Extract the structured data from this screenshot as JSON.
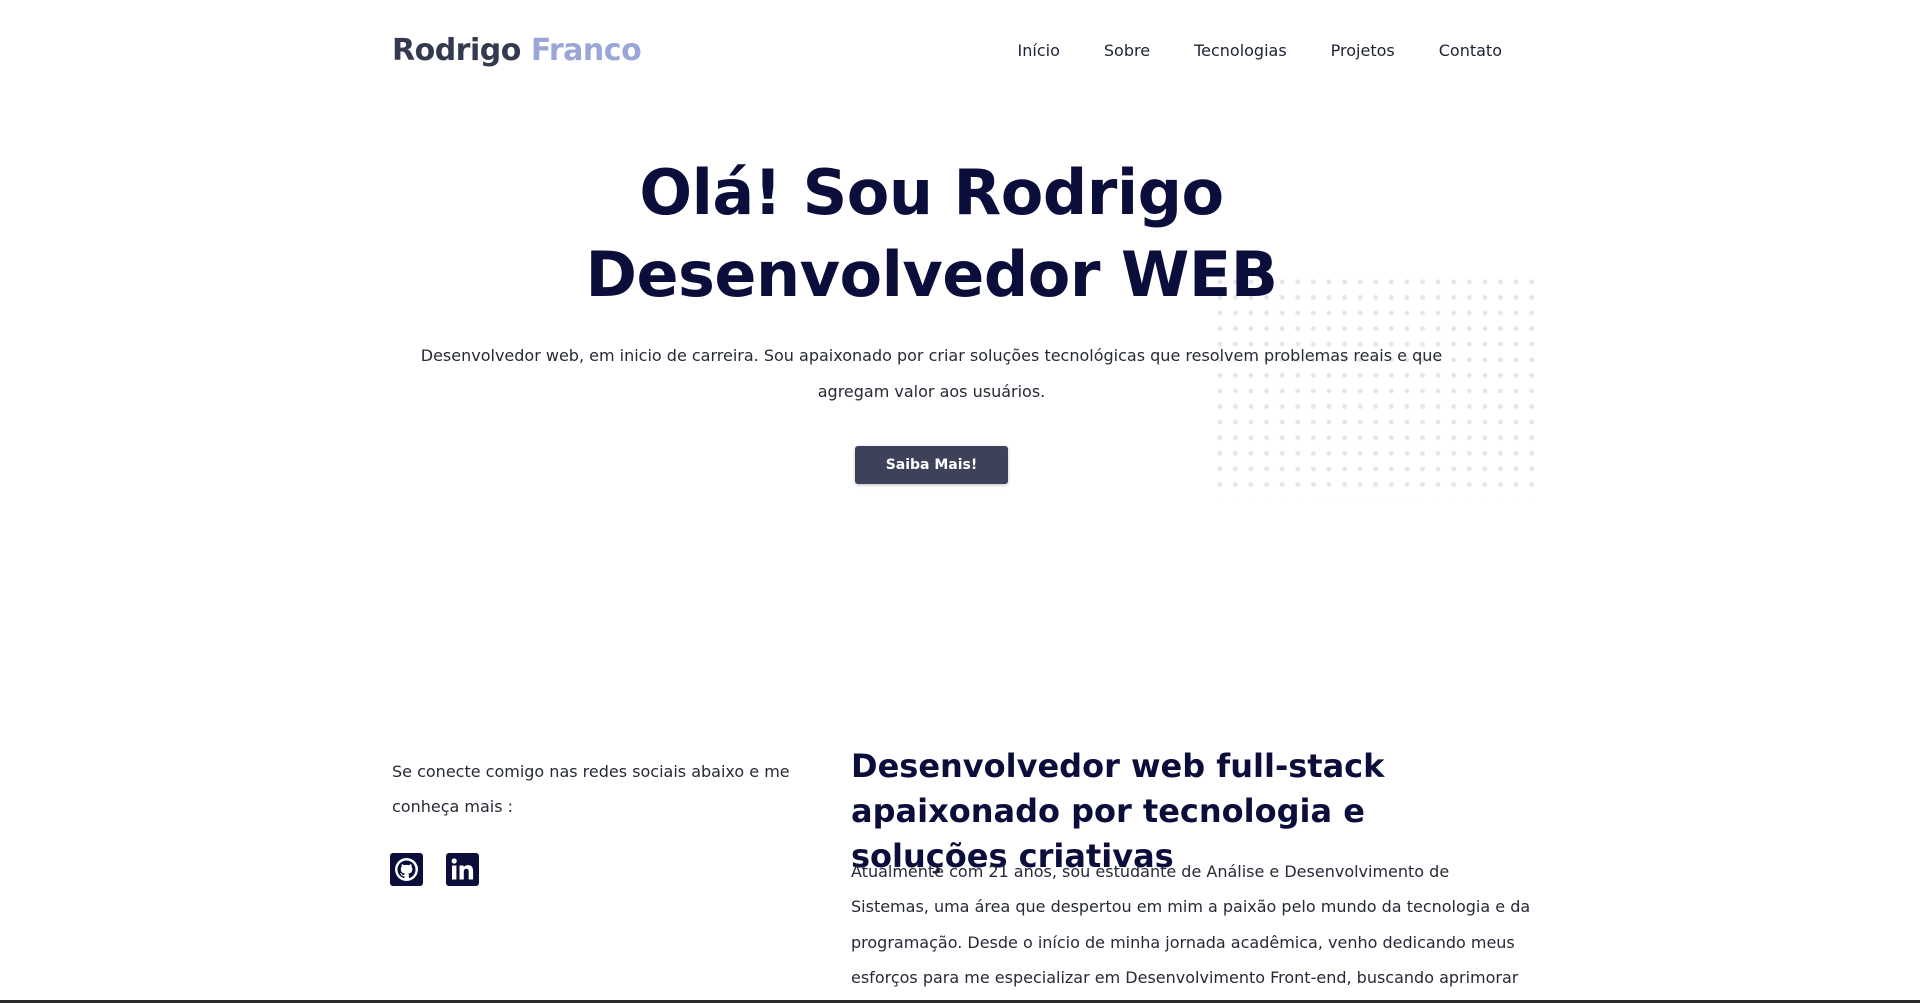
{
  "header": {
    "logo_first": "Rodrigo",
    "logo_last": "Franco",
    "nav": [
      "Início",
      "Sobre",
      "Tecnologias",
      "Projetos",
      "Contato"
    ]
  },
  "hero": {
    "title": "Olá! Sou Rodrigo Desenvolvedor WEB",
    "description": "Desenvolvedor web, em inicio de carreira. Sou apaixonado por criar soluções tecnológicas que resolvem problemas reais e que agregam valor aos usuários.",
    "cta_label": "Saiba Mais!"
  },
  "about": {
    "social_text": "Se conecte comigo nas redes sociais abaixo e me conheça mais :",
    "social_icons": [
      "github-icon",
      "linkedin-icon"
    ],
    "title": "Desenvolvedor web full-stack apaixonado por tecnologia e soluções criativas",
    "text": "Atualmente com 21 anos, sou estudante de Análise e Desenvolvimento de Sistemas, uma área que despertou em mim a paixão pelo mundo da tecnologia e da programação. Desde o início de minha jornada acadêmica, venho dedicando meus esforços para me especializar em Desenvolvimento Front-end, buscando aprimorar minhas habilidades e"
  },
  "colors": {
    "primary_text": "#0b0d3a",
    "logo_accent": "#9aa5d8",
    "button_bg": "#3d4159"
  }
}
